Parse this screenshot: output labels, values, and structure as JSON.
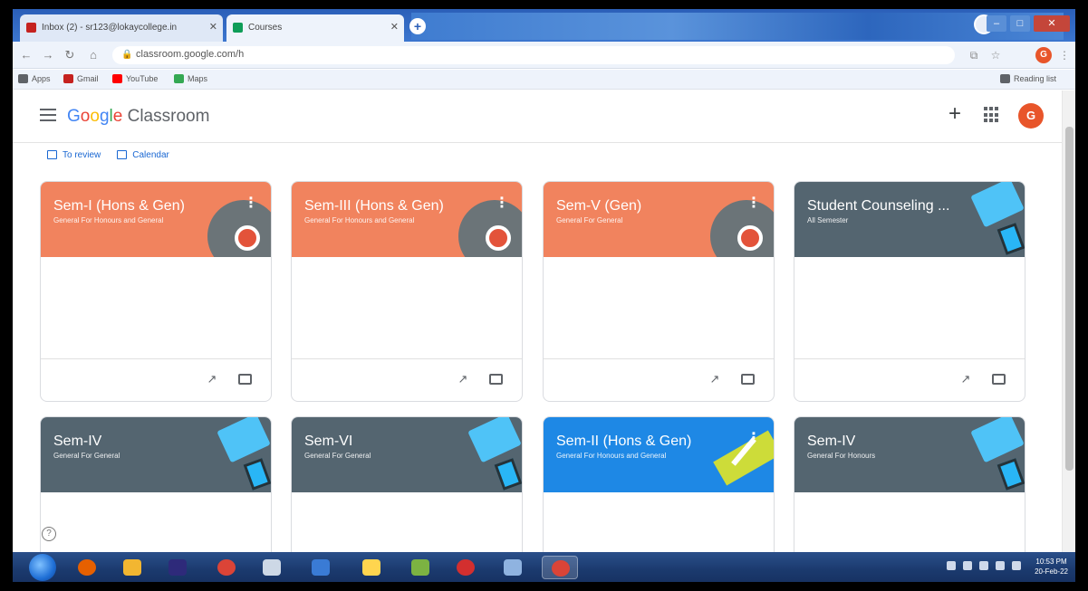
{
  "browser": {
    "tabs": [
      {
        "label": "Inbox (2) - sr123@lokaycollege.in",
        "active": false,
        "favicon_color": "#c5221f"
      },
      {
        "label": "Courses",
        "active": true,
        "favicon_color": "#0f9d58"
      }
    ],
    "new_tab_label": "+",
    "url": "classroom.google.com/h",
    "bookmarks": [
      {
        "label": "Apps",
        "color": "#5f6368"
      },
      {
        "label": "Gmail",
        "color": "#c5221f"
      },
      {
        "label": "YouTube",
        "color": "#ff0000"
      },
      {
        "label": "Maps",
        "color": "#34a853"
      }
    ],
    "reading_list_label": "Reading list",
    "profile_initial": "G"
  },
  "header": {
    "logo_parts": [
      "G",
      "o",
      "o",
      "g",
      "l",
      "e"
    ],
    "logo_suffix": " Classroom",
    "avatar_initial": "G",
    "plus_label": "+"
  },
  "subnav": {
    "to_review": "To review",
    "calendar": "Calendar"
  },
  "cards": [
    {
      "title": "Sem-I (Hons & Gen)",
      "subtitle": "General For Honours and General",
      "theme": "orange"
    },
    {
      "title": "Sem-III (Hons & Gen)",
      "subtitle": "General For Honours and General",
      "theme": "orange"
    },
    {
      "title": "Sem-V (Gen)",
      "subtitle": "General For General",
      "theme": "orange"
    },
    {
      "title": "Student Counseling ...",
      "subtitle": "All Semester",
      "theme": "slate"
    },
    {
      "title": "Sem-IV",
      "subtitle": "General For General",
      "theme": "slate"
    },
    {
      "title": "Sem-VI",
      "subtitle": "General For General",
      "theme": "slate"
    },
    {
      "title": "Sem-II (Hons & Gen)",
      "subtitle": "General For Honours and General",
      "theme": "blue"
    },
    {
      "title": "Sem-IV",
      "subtitle": "General For Honours",
      "theme": "slate"
    }
  ],
  "card_menu_glyph": "⋮",
  "taskbar": {
    "time": "10:53 PM",
    "date": "20-Feb-22",
    "apps": [
      {
        "name": "firefox",
        "color": "#e66000"
      },
      {
        "name": "folder",
        "color": "#f2b631"
      },
      {
        "name": "media-player",
        "color": "#2e2a7a"
      },
      {
        "name": "chrome",
        "color": "#db4437"
      },
      {
        "name": "document",
        "color": "#cdd8e6"
      },
      {
        "name": "mail",
        "color": "#3a7bd5"
      },
      {
        "name": "notes",
        "color": "#ffd54f"
      },
      {
        "name": "paint",
        "color": "#7cb342"
      },
      {
        "name": "opera",
        "color": "#d32f2f"
      },
      {
        "name": "network",
        "color": "#8fb3e0"
      },
      {
        "name": "chrome-active",
        "color": "#db4437"
      }
    ]
  },
  "help_glyph": "?"
}
